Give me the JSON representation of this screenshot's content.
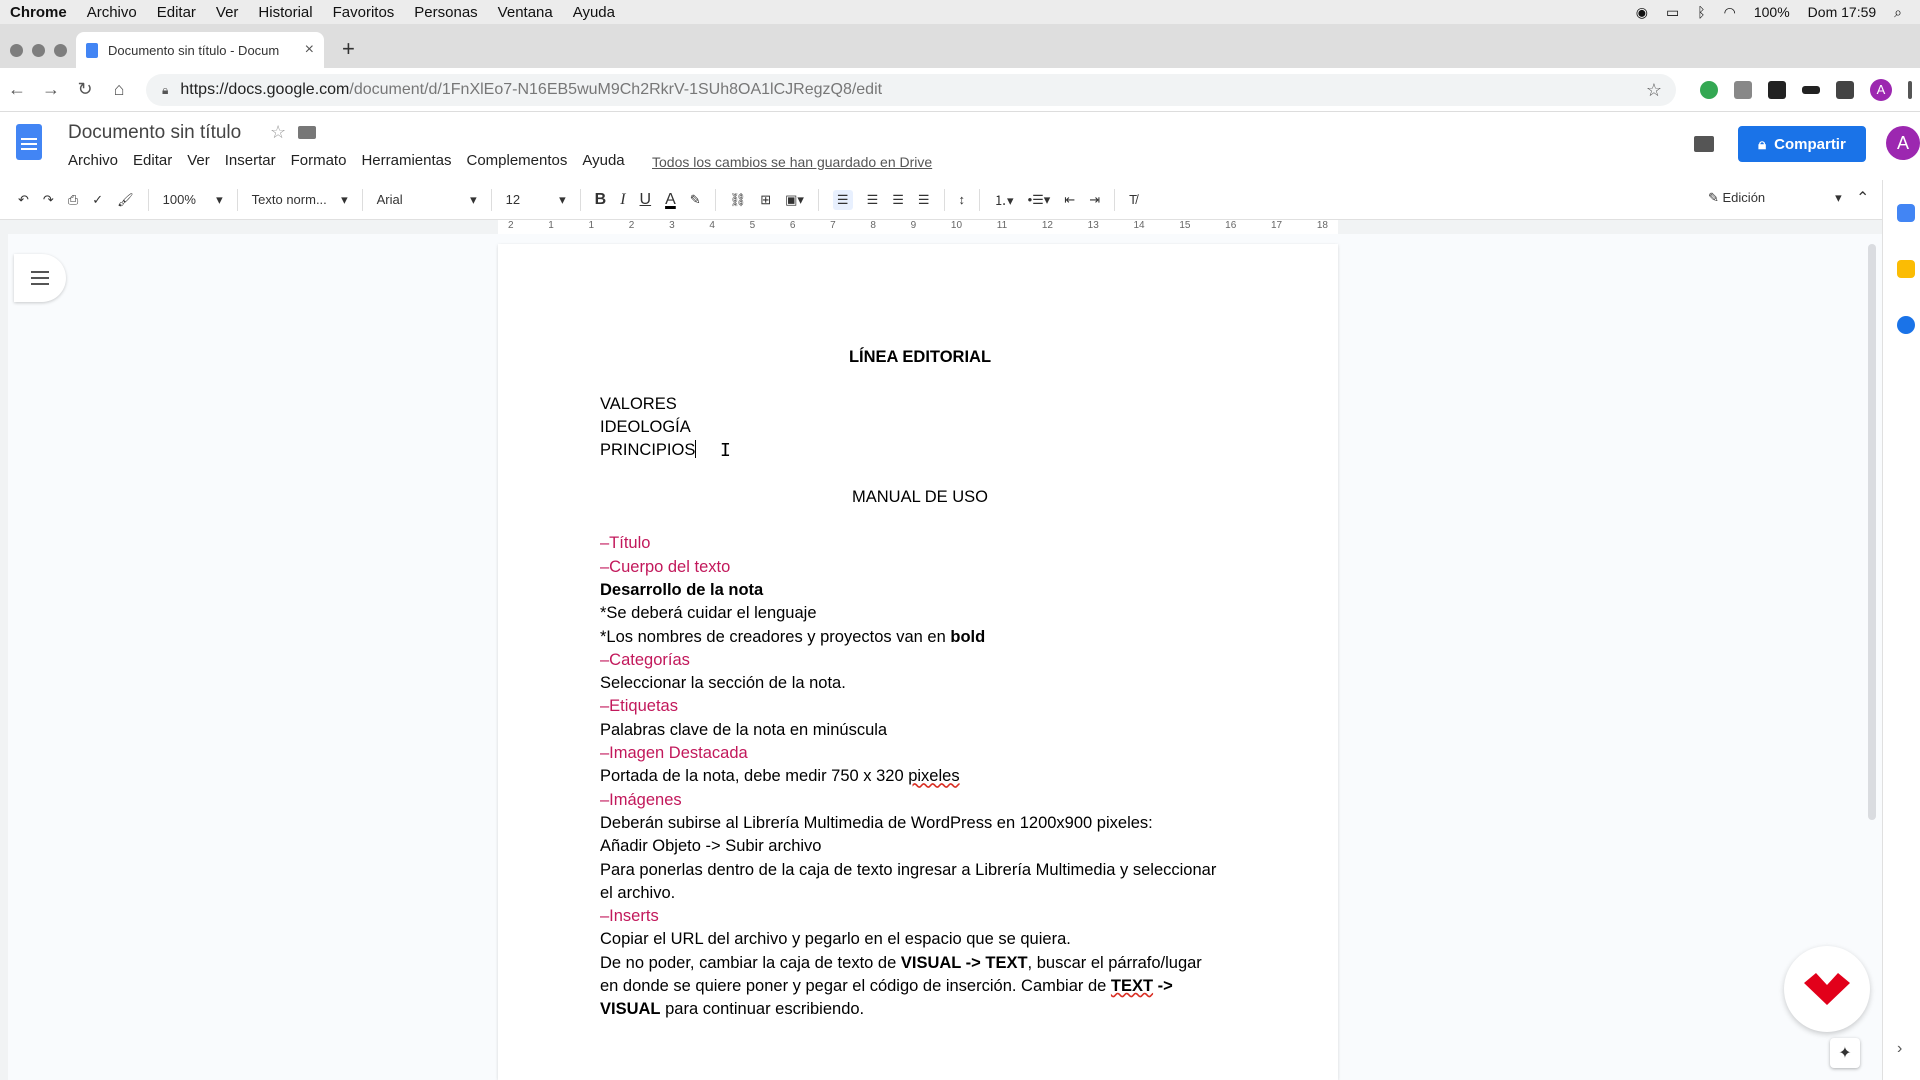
{
  "macos": {
    "app": "Chrome",
    "menu": [
      "Archivo",
      "Editar",
      "Ver",
      "Historial",
      "Favoritos",
      "Personas",
      "Ventana",
      "Ayuda"
    ],
    "battery": "100%",
    "clock": "Dom 17:59"
  },
  "browser": {
    "tab_title": "Documento sin título - Docum",
    "url_host": "https://docs.google.com",
    "url_path": "/document/d/1FnXlEo7-N16EB5wuM9Ch2RkrV-1SUh8OA1lCJRegzQ8/edit",
    "profile_initial": "A"
  },
  "docs": {
    "title": "Documento sin título",
    "menu": [
      "Archivo",
      "Editar",
      "Ver",
      "Insertar",
      "Formato",
      "Herramientas",
      "Complementos",
      "Ayuda"
    ],
    "saved_status": "Todos los cambios se han guardado en Drive",
    "share_label": "Compartir",
    "avatar_initial": "A"
  },
  "toolbar": {
    "zoom": "100%",
    "style": "Texto norm...",
    "font": "Arial",
    "size": "12",
    "bold": "B",
    "italic": "I",
    "underline": "U",
    "text_color": "A",
    "mode": "Edición"
  },
  "ruler": [
    "2",
    "1",
    "1",
    "2",
    "3",
    "4",
    "5",
    "6",
    "7",
    "8",
    "9",
    "10",
    "11",
    "12",
    "13",
    "14",
    "15",
    "16",
    "17",
    "18"
  ],
  "document": {
    "heading": "LÍNEA EDITORIAL",
    "values": [
      "VALORES",
      "IDEOLOGÍA",
      "PRINCIPIOS"
    ],
    "manual_title": "MANUAL DE USO",
    "l1": "–Título",
    "l2": "–Cuerpo del texto",
    "l3": "Desarrollo de la nota",
    "l4": "*Se deberá cuidar el lenguaje",
    "l5a": "*Los nombres de creadores y proyectos van en ",
    "l5b": "bold",
    "l6": "–Categorías",
    "l7": "Seleccionar la sección de la nota.",
    "l8": "–Etiquetas",
    "l9": "Palabras clave de la nota en minúscula",
    "l10": "–Imagen Destacada",
    "l11a": "Portada de la nota, debe medir 750 x 320 ",
    "l11b": "pixeles",
    "l12": "–Imágenes",
    "l13": "Deberán subirse al Librería Multimedia de WordPress en 1200x900 pixeles:",
    "l14": "Añadir Objeto -> Subir archivo",
    "l15": "Para ponerlas dentro de la caja de texto ingresar a Librería Multimedia y seleccionar",
    "l16": "el archivo.",
    "l17": "–Inserts",
    "l18": "Copiar el URL del archivo y pegarlo en el espacio que se quiera.",
    "l19a": "De no poder, cambiar la caja de texto de ",
    "l19b": "VISUAL -> TEXT",
    "l19c": ", buscar el párrafo/lugar",
    "l20a": "en donde se quiere poner y pegar el código de inserción. Cambiar de ",
    "l20b": "TEXT",
    "l20c": " ->",
    "l21a": "VISUAL",
    "l21b": " para continuar escribiendo."
  },
  "colors": {
    "accent": "#1a73e8",
    "section_pink": "#c2185b",
    "logo_red": "#e2001a"
  }
}
